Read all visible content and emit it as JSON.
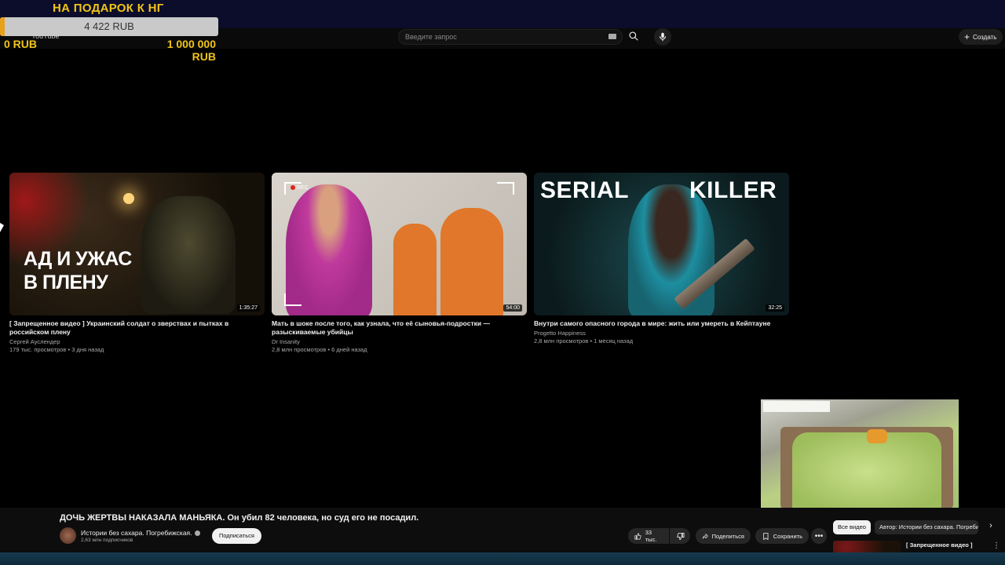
{
  "donation": {
    "title": "НА ПОДАРОК К НГ",
    "current": "4 422 RUB",
    "min": "0 RUB",
    "max": "1 000 000 RUB",
    "progress_fraction": 0.004422,
    "accent_color": "#f0c419"
  },
  "masthead": {
    "logo_text": "YouTube",
    "search_placeholder": "Введите запрос",
    "create_label": "Создать"
  },
  "videos": [
    {
      "title": "[ Запрещенное видео ] Украинский солдат о зверствах и пытках в российском плену",
      "channel": "Сергей Ауслендер",
      "meta": "179 тыс. просмотров • 3 дня назад",
      "duration": "1:35:27",
      "thumb_text_line1": "АД И УЖАС",
      "thumb_text_line2": "В ПЛЕНУ"
    },
    {
      "title": "Мать в шоке после того, как узнала, что её сыновья-подростки — разыскиваемые убийцы",
      "channel": "Dr Insanity",
      "meta": "2,8 млн просмотров • 6 дней назад",
      "duration": "54:00",
      "thumb_rec": "REC"
    },
    {
      "title": "Внутри самого опасного города в мире: жить или умереть в Кейптауне",
      "channel": "Progetto Happiness",
      "meta": "2,8 млн просмотров • 1 месяц назад",
      "duration": "32:25",
      "thumb_text_line1": "SERIAL",
      "thumb_text_line2": "KILLER"
    }
  ],
  "now_playing": {
    "title": "ДОЧЬ ЖЕРТВЫ НАКАЗАЛА МАНЬЯКА. Он убил 82 человека, но суд его не посадил.",
    "channel": "Истории без сахара. Погребижская.",
    "subscribers": "2,63 млн подписчиков",
    "subscribe_label": "Подписаться",
    "likes": "33 тыс.",
    "share_label": "Поделиться",
    "save_label": "Сохранить"
  },
  "related": {
    "chip_all": "Все видео",
    "chip_author": "Автор: Истории без сахара. Погребижская.",
    "first_title": "[ Запрещенное видео ]"
  }
}
